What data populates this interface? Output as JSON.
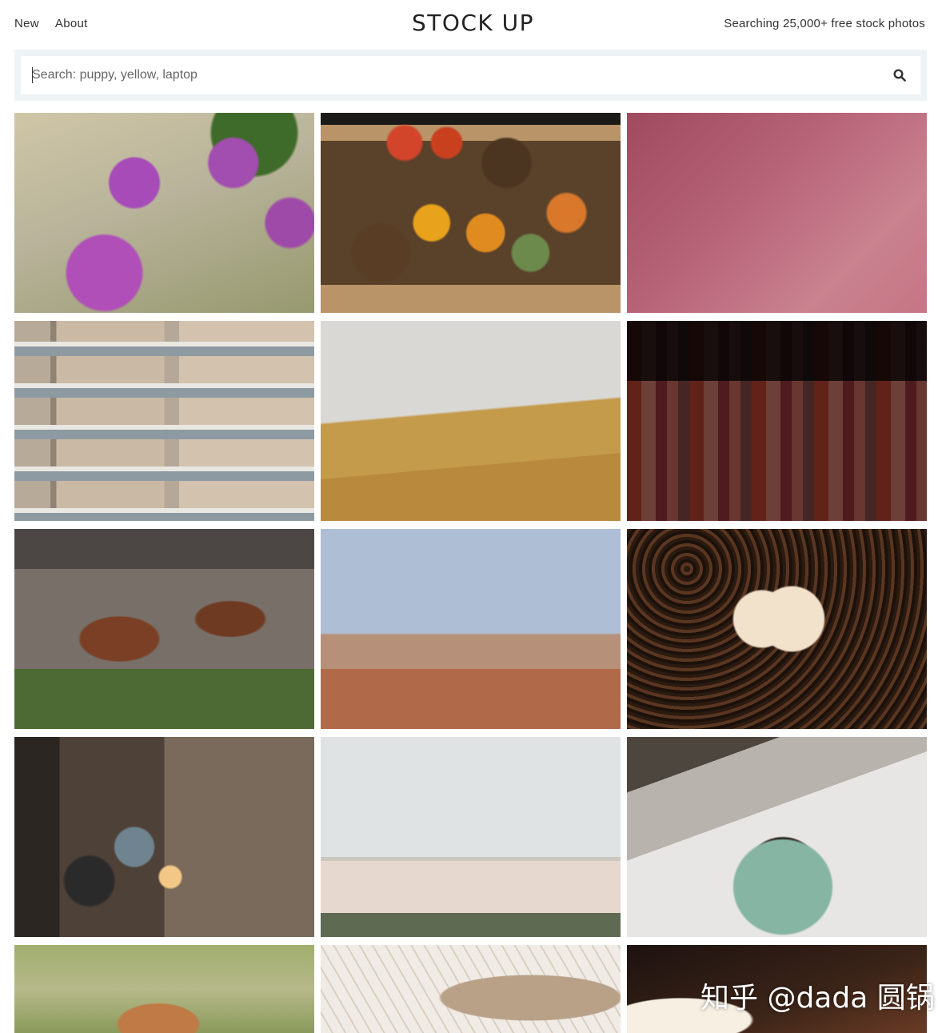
{
  "nav": {
    "items": [
      "New",
      "About"
    ]
  },
  "brand": {
    "title": "STOCK UP"
  },
  "tagline": "Searching 25,000+ free stock photos",
  "search": {
    "placeholder": "Search: puppy, yellow, laptop",
    "value": ""
  },
  "watermark": "知乎 @dada 圆锅",
  "photos": [
    {
      "subject": "purple allium flowers"
    },
    {
      "subject": "basket with dried fruit and pinecones"
    },
    {
      "subject": "pink blur"
    },
    {
      "subject": "apartment building"
    },
    {
      "subject": "people on golden field"
    },
    {
      "subject": "clothes rack"
    },
    {
      "subject": "two horses"
    },
    {
      "subject": "desert mountains"
    },
    {
      "subject": "coffee beans heart"
    },
    {
      "subject": "desk with camera"
    },
    {
      "subject": "palace"
    },
    {
      "subject": "green coffee mug"
    },
    {
      "subject": "fox"
    },
    {
      "subject": "fabric"
    },
    {
      "subject": "coffee cup"
    }
  ]
}
